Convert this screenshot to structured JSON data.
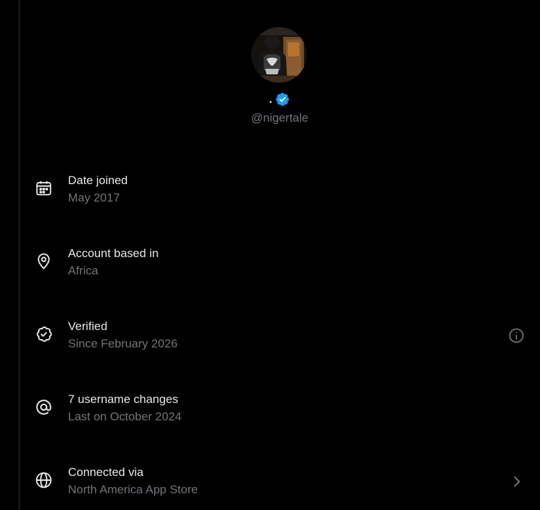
{
  "profile": {
    "display_name": ".",
    "handle": "@nigertale",
    "verified": true
  },
  "colors": {
    "background": "#000000",
    "primary_text": "#e7e9ea",
    "secondary_text": "#71767b",
    "verified_blue": "#1d9bf0",
    "divider": "#2f3336"
  },
  "info_rows": [
    {
      "icon": "calendar-icon",
      "title": "Date joined",
      "subtitle": "May 2017",
      "trailing": null
    },
    {
      "icon": "location-pin-icon",
      "title": "Account based in",
      "subtitle": "Africa",
      "trailing": "info-icon"
    },
    {
      "icon": "verified-badge-icon",
      "title": "Verified",
      "subtitle": "Since February 2026",
      "trailing": "chevron-right-icon"
    },
    {
      "icon": "at-sign-icon",
      "title": "7 username changes",
      "subtitle": "Last on October 2024",
      "trailing": null
    },
    {
      "icon": "globe-icon",
      "title": "Connected via",
      "subtitle": "North America App Store",
      "trailing": null
    }
  ]
}
